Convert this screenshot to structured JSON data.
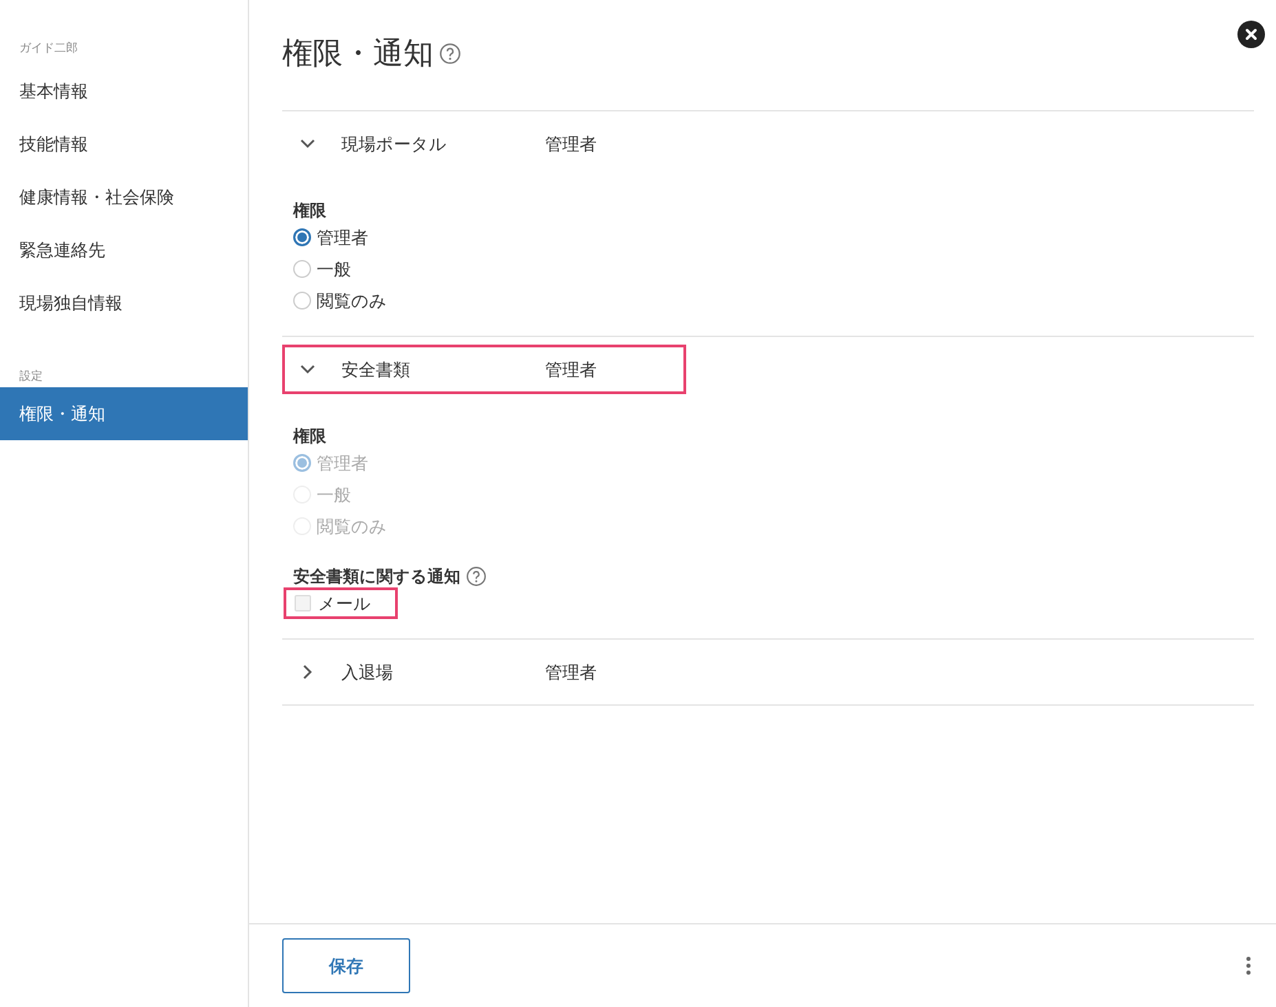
{
  "sidebar": {
    "user_name": "ガイド二郎",
    "items": [
      {
        "label": "基本情報",
        "selected": false
      },
      {
        "label": "技能情報",
        "selected": false
      },
      {
        "label": "健康情報・社会保険",
        "selected": false
      },
      {
        "label": "緊急連絡先",
        "selected": false
      },
      {
        "label": "現場独自情報",
        "selected": false
      }
    ],
    "settings_heading": "設定",
    "settings_items": [
      {
        "label": "権限・通知",
        "selected": true
      }
    ]
  },
  "title": "権限・通知",
  "sections": [
    {
      "name": "現場ポータル",
      "role": "管理者",
      "expanded": true,
      "highlighted": false,
      "permission_label": "権限",
      "disabled": false,
      "options": [
        {
          "label": "管理者",
          "selected": true
        },
        {
          "label": "一般",
          "selected": false
        },
        {
          "label": "閲覧のみ",
          "selected": false
        }
      ]
    },
    {
      "name": "安全書類",
      "role": "管理者",
      "expanded": true,
      "highlighted": true,
      "permission_label": "権限",
      "disabled": true,
      "options": [
        {
          "label": "管理者",
          "selected": true
        },
        {
          "label": "一般",
          "selected": false
        },
        {
          "label": "閲覧のみ",
          "selected": false
        }
      ],
      "notification": {
        "label": "安全書類に関する通知",
        "options": [
          {
            "label": "メール",
            "checked": false,
            "highlighted": true
          }
        ]
      }
    },
    {
      "name": "入退場",
      "role": "管理者",
      "expanded": false,
      "highlighted": false
    }
  ],
  "save_button": "保存"
}
